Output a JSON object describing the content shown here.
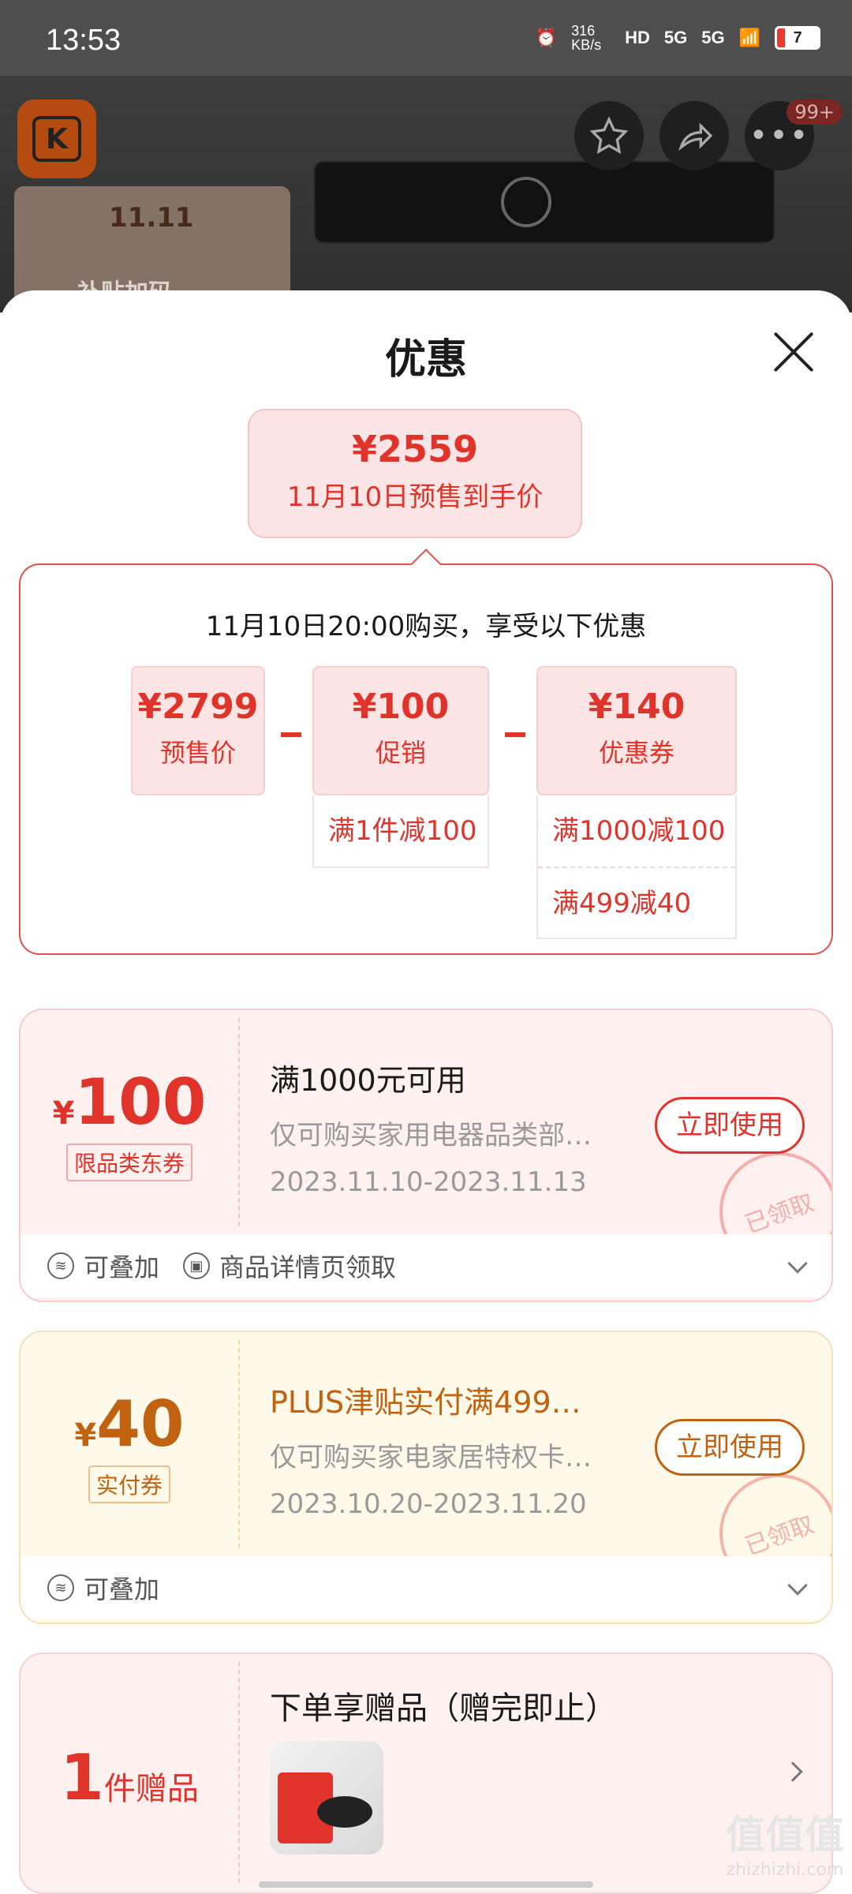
{
  "status_bar": {
    "time": "13:53",
    "net_speed": "316 KB/s",
    "hd": "HD",
    "signal1": "5G",
    "signal2": "5G",
    "battery": "7"
  },
  "header": {
    "badge": "99+",
    "promo_title": "11.11",
    "promo_sub": "补贴加码"
  },
  "sheet": {
    "title": "优惠",
    "final_price": "¥2559",
    "final_label": "11月10日预售到手价",
    "calc_heading": "11月10日20:00购买，享受以下优惠",
    "presale_price": "¥2799",
    "presale_label": "预售价",
    "promo_price": "¥100",
    "promo_label": "促销",
    "promo_rule": "满1件减100",
    "coupon_price": "¥140",
    "coupon_label": "优惠券",
    "coupon_rule1": "满1000减100",
    "coupon_rule2": "满499减40"
  },
  "coupons": [
    {
      "currency": "¥",
      "amount": "100",
      "tag": "限品类东券",
      "title": "满1000元可用",
      "desc": "仅可购买家用电器品类部…",
      "date": "2023.11.10-2023.11.13",
      "button": "立即使用",
      "stamp": "已领取",
      "foot1": "可叠加",
      "foot2": "商品详情页领取",
      "accent": "#e0332a"
    },
    {
      "currency": "¥",
      "amount": "40",
      "tag": "实付券",
      "title": "PLUS津贴实付满499…",
      "desc": "仅可购买家电家居特权卡…",
      "date": "2023.10.20-2023.11.20",
      "button": "立即使用",
      "stamp": "已领取",
      "foot1": "可叠加",
      "accent": "#c0620f"
    }
  ],
  "gift": {
    "count": "1",
    "unit": "件赠品",
    "title": "下单享赠品（赠完即止）"
  },
  "watermark": {
    "big": "值值值",
    "small": "zhizhizhi.com"
  }
}
